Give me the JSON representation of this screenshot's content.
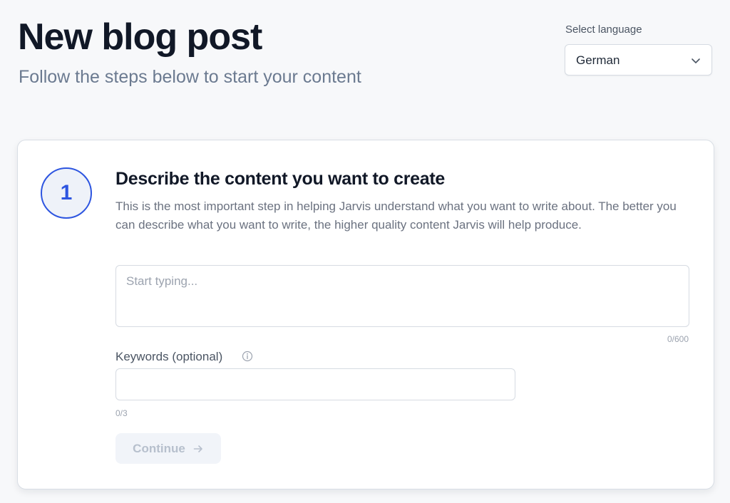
{
  "header": {
    "title": "New blog post",
    "subtitle": "Follow the steps below to start your content"
  },
  "language": {
    "label": "Select language",
    "selected": "German"
  },
  "step": {
    "number": "1",
    "heading": "Describe the content you want to create",
    "description": "This is the most important step in helping Jarvis understand what you want to write about. The better you can describe what you want to write, the higher quality content Jarvis will help produce."
  },
  "content_input": {
    "value": "",
    "placeholder": "Start typing...",
    "counter": "0/600"
  },
  "keywords": {
    "label": "Keywords (optional)",
    "value": "",
    "placeholder": "",
    "counter": "0/3"
  },
  "continue_button": {
    "label": "Continue",
    "disabled": true
  },
  "icons": {
    "dropdown": "chevron-down-icon",
    "info": "info-icon",
    "continue": "arrow-right-icon"
  },
  "colors": {
    "accent": "#2d55e0",
    "background": "#f7f8fa",
    "card": "#ffffff",
    "muted_text": "#6b7280",
    "disabled_button_bg": "#f1f4f9",
    "disabled_button_text": "#b7c0cd"
  }
}
